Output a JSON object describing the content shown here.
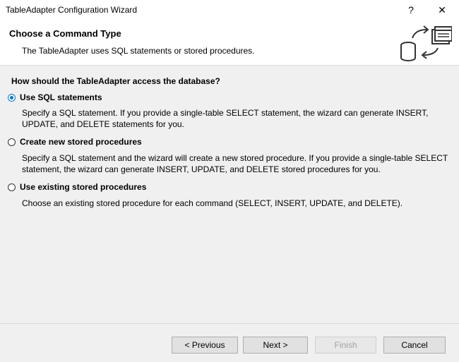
{
  "window": {
    "title": "TableAdapter Configuration Wizard",
    "help_glyph": "?",
    "close_glyph": "✕"
  },
  "header": {
    "title": "Choose a Command Type",
    "subtitle": "The TableAdapter uses SQL statements or stored procedures.",
    "icon": "database-command-icon"
  },
  "question": "How should the TableAdapter access the database?",
  "options": [
    {
      "label": "Use SQL statements",
      "checked": true,
      "description": "Specify a SQL statement. If you provide a single-table SELECT statement, the wizard can generate INSERT, UPDATE, and DELETE statements for you."
    },
    {
      "label": "Create new stored procedures",
      "checked": false,
      "description": "Specify a SQL statement and the wizard will create a new stored procedure. If you provide a single-table SELECT statement, the wizard can generate INSERT, UPDATE, and DELETE stored procedures for you."
    },
    {
      "label": "Use existing stored procedures",
      "checked": false,
      "description": "Choose an existing stored procedure for each command (SELECT, INSERT, UPDATE, and DELETE)."
    }
  ],
  "buttons": {
    "previous": "< Previous",
    "next": "Next >",
    "finish": "Finish",
    "cancel": "Cancel"
  }
}
